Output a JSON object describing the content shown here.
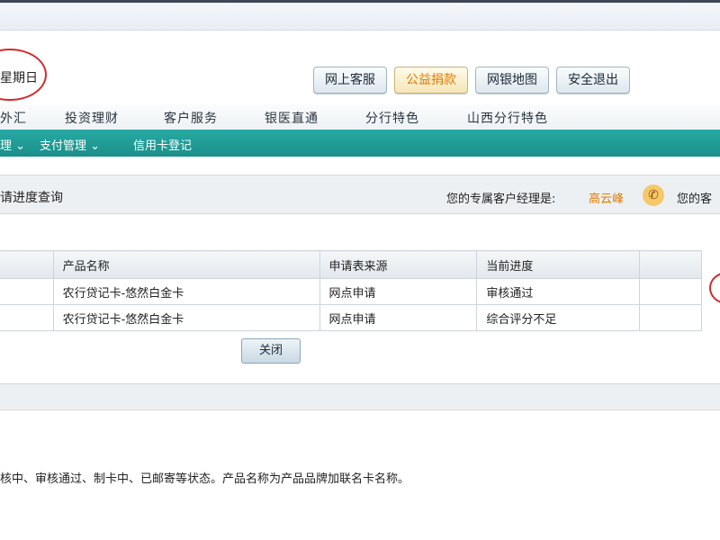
{
  "header": {
    "weekday": "星期日",
    "buttons": [
      "网上客服",
      "公益捐款",
      "网银地图",
      "安全退出"
    ]
  },
  "main_nav": [
    "外汇",
    "投资理财",
    "客户服务",
    "银医直通",
    "分行特色",
    "山西分行特色"
  ],
  "sub_nav": [
    "理",
    "支付管理",
    "信用卡登记"
  ],
  "section": {
    "title": "请进度查询",
    "manager_label": "您的专属客户经理是:",
    "manager_name": "高云峰",
    "manager_label_2": "您的客"
  },
  "table": {
    "headers": [
      "",
      "产品名称",
      "申请表来源",
      "当前进度"
    ],
    "rows": [
      [
        "",
        "农行贷记卡-悠然白金卡",
        "网点申请",
        "审核通过"
      ],
      [
        "",
        "农行贷记卡-悠然白金卡",
        "网点申请",
        "综合评分不足"
      ]
    ]
  },
  "close_label": "关闭",
  "note": "核中、审核通过、制卡中、已邮寄等状态。产品名称为产品品牌加联名卡名称。",
  "colors": {
    "accent": "#e07a00",
    "teal": "#1b9a94",
    "annotation": "#d32b2b"
  }
}
